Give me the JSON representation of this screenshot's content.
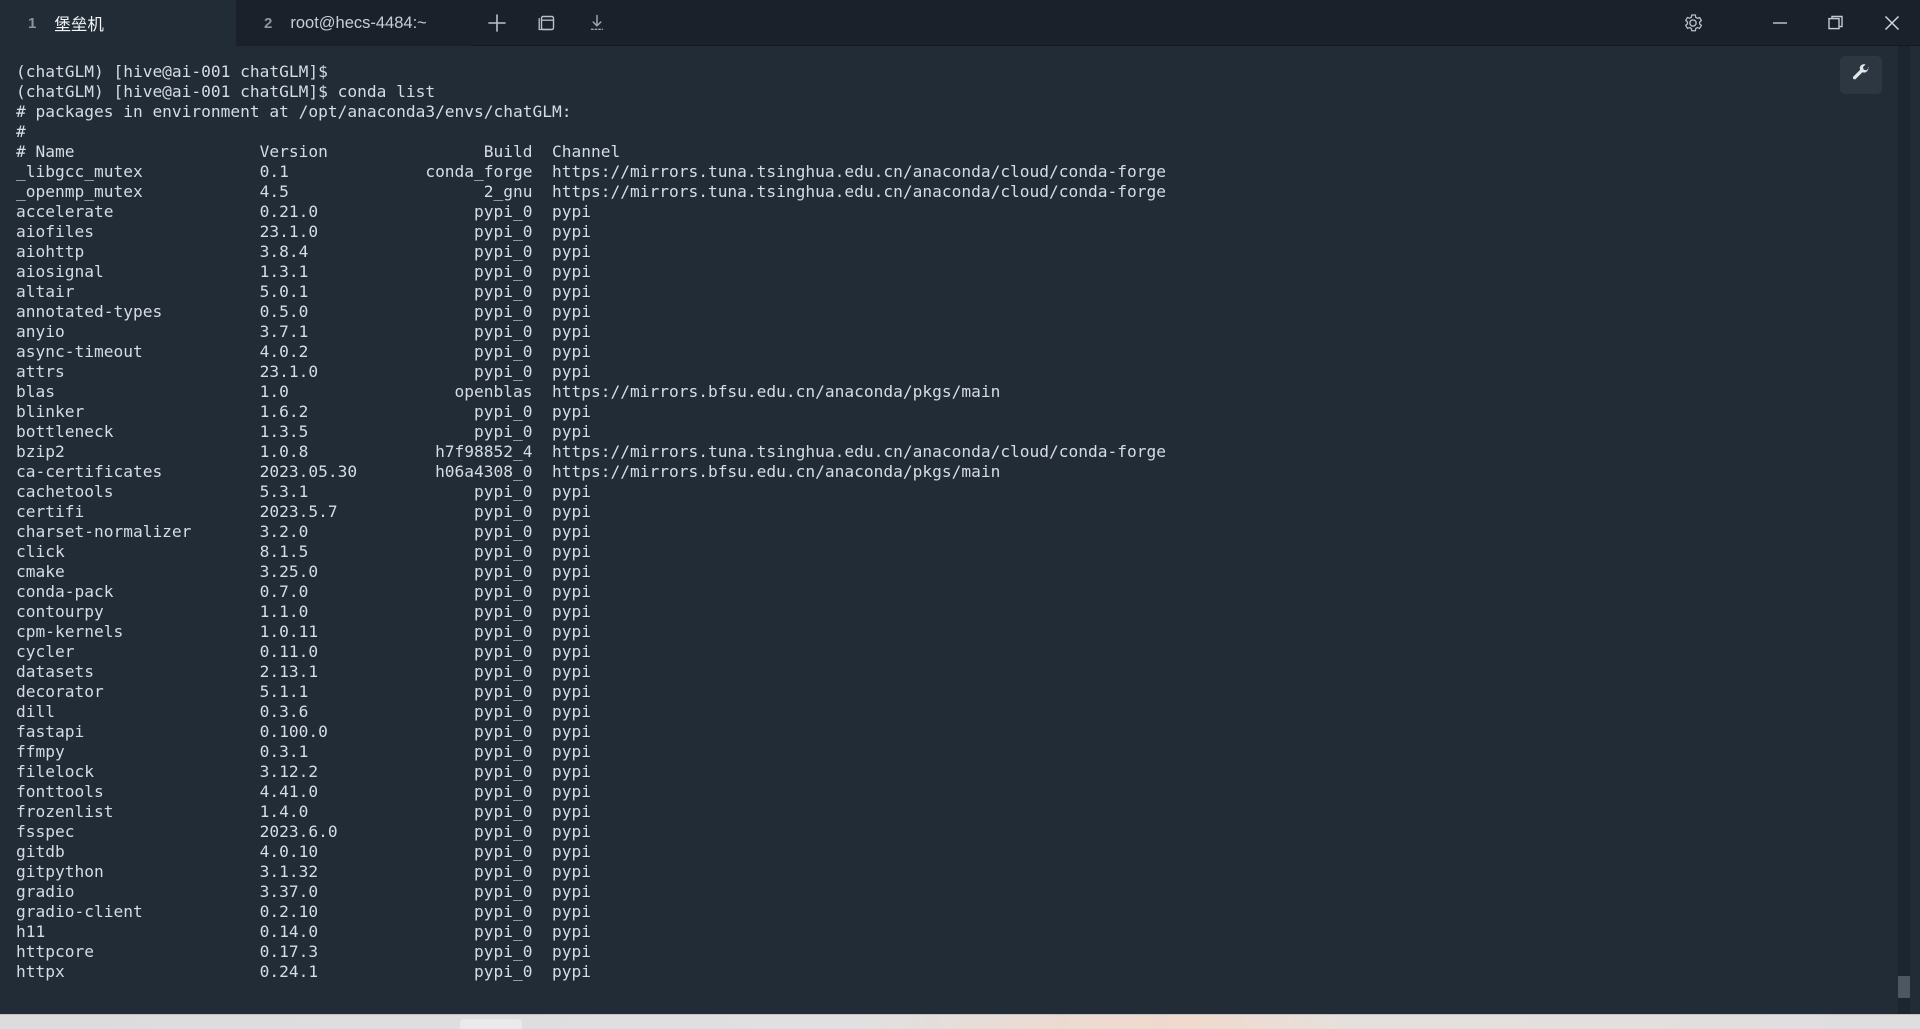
{
  "window": {
    "tabs": [
      {
        "number": "1",
        "label": "堡垒机",
        "active": true
      },
      {
        "number": "2",
        "label": "root@hecs-4484:~",
        "active": false
      }
    ],
    "tab_actions": [
      {
        "name": "new-tab-icon",
        "title": "+"
      },
      {
        "name": "split-window-icon",
        "title": "窗口"
      },
      {
        "name": "download-icon",
        "title": "下载"
      }
    ],
    "controls": [
      {
        "name": "gear-icon",
        "label": "设置"
      },
      {
        "name": "minimize-icon",
        "label": "最小化"
      },
      {
        "name": "restore-icon",
        "label": "还原"
      },
      {
        "name": "close-icon",
        "label": "关闭"
      }
    ],
    "tool_button": {
      "name": "wrench-icon",
      "label": "工具"
    }
  },
  "colors": {
    "terminal_bg": "#222c37",
    "titlebar_bg": "#1a212b",
    "active_tab_bg": "#222c37",
    "text": "#d6dce3",
    "scrollbar_thumb": "#4d5761"
  },
  "terminal": {
    "prompt": "(chatGLM) [hive@ai-001 chatGLM]$",
    "command": "conda list",
    "header_lines": [
      "(chatGLM) [hive@ai-001 chatGLM]$",
      "(chatGLM) [hive@ai-001 chatGLM]$ conda list",
      "# packages in environment at /opt/anaconda3/envs/chatGLM:",
      "#"
    ],
    "columns": {
      "name": "# Name",
      "version": "Version",
      "build": "Build",
      "channel": "Channel"
    },
    "column_offsets": {
      "name": 0,
      "version": 25,
      "build_end": 53,
      "channel": 56
    },
    "packages": [
      {
        "name": "_libgcc_mutex",
        "version": "0.1",
        "build": "conda_forge",
        "channel": "https://mirrors.tuna.tsinghua.edu.cn/anaconda/cloud/conda-forge"
      },
      {
        "name": "_openmp_mutex",
        "version": "4.5",
        "build": "2_gnu",
        "channel": "https://mirrors.tuna.tsinghua.edu.cn/anaconda/cloud/conda-forge"
      },
      {
        "name": "accelerate",
        "version": "0.21.0",
        "build": "pypi_0",
        "channel": "pypi"
      },
      {
        "name": "aiofiles",
        "version": "23.1.0",
        "build": "pypi_0",
        "channel": "pypi"
      },
      {
        "name": "aiohttp",
        "version": "3.8.4",
        "build": "pypi_0",
        "channel": "pypi"
      },
      {
        "name": "aiosignal",
        "version": "1.3.1",
        "build": "pypi_0",
        "channel": "pypi"
      },
      {
        "name": "altair",
        "version": "5.0.1",
        "build": "pypi_0",
        "channel": "pypi"
      },
      {
        "name": "annotated-types",
        "version": "0.5.0",
        "build": "pypi_0",
        "channel": "pypi"
      },
      {
        "name": "anyio",
        "version": "3.7.1",
        "build": "pypi_0",
        "channel": "pypi"
      },
      {
        "name": "async-timeout",
        "version": "4.0.2",
        "build": "pypi_0",
        "channel": "pypi"
      },
      {
        "name": "attrs",
        "version": "23.1.0",
        "build": "pypi_0",
        "channel": "pypi"
      },
      {
        "name": "blas",
        "version": "1.0",
        "build": "openblas",
        "channel": "https://mirrors.bfsu.edu.cn/anaconda/pkgs/main"
      },
      {
        "name": "blinker",
        "version": "1.6.2",
        "build": "pypi_0",
        "channel": "pypi"
      },
      {
        "name": "bottleneck",
        "version": "1.3.5",
        "build": "pypi_0",
        "channel": "pypi"
      },
      {
        "name": "bzip2",
        "version": "1.0.8",
        "build": "h7f98852_4",
        "channel": "https://mirrors.tuna.tsinghua.edu.cn/anaconda/cloud/conda-forge"
      },
      {
        "name": "ca-certificates",
        "version": "2023.05.30",
        "build": "h06a4308_0",
        "channel": "https://mirrors.bfsu.edu.cn/anaconda/pkgs/main"
      },
      {
        "name": "cachetools",
        "version": "5.3.1",
        "build": "pypi_0",
        "channel": "pypi"
      },
      {
        "name": "certifi",
        "version": "2023.5.7",
        "build": "pypi_0",
        "channel": "pypi"
      },
      {
        "name": "charset-normalizer",
        "version": "3.2.0",
        "build": "pypi_0",
        "channel": "pypi"
      },
      {
        "name": "click",
        "version": "8.1.5",
        "build": "pypi_0",
        "channel": "pypi"
      },
      {
        "name": "cmake",
        "version": "3.25.0",
        "build": "pypi_0",
        "channel": "pypi"
      },
      {
        "name": "conda-pack",
        "version": "0.7.0",
        "build": "pypi_0",
        "channel": "pypi"
      },
      {
        "name": "contourpy",
        "version": "1.1.0",
        "build": "pypi_0",
        "channel": "pypi"
      },
      {
        "name": "cpm-kernels",
        "version": "1.0.11",
        "build": "pypi_0",
        "channel": "pypi"
      },
      {
        "name": "cycler",
        "version": "0.11.0",
        "build": "pypi_0",
        "channel": "pypi"
      },
      {
        "name": "datasets",
        "version": "2.13.1",
        "build": "pypi_0",
        "channel": "pypi"
      },
      {
        "name": "decorator",
        "version": "5.1.1",
        "build": "pypi_0",
        "channel": "pypi"
      },
      {
        "name": "dill",
        "version": "0.3.6",
        "build": "pypi_0",
        "channel": "pypi"
      },
      {
        "name": "fastapi",
        "version": "0.100.0",
        "build": "pypi_0",
        "channel": "pypi"
      },
      {
        "name": "ffmpy",
        "version": "0.3.1",
        "build": "pypi_0",
        "channel": "pypi"
      },
      {
        "name": "filelock",
        "version": "3.12.2",
        "build": "pypi_0",
        "channel": "pypi"
      },
      {
        "name": "fonttools",
        "version": "4.41.0",
        "build": "pypi_0",
        "channel": "pypi"
      },
      {
        "name": "frozenlist",
        "version": "1.4.0",
        "build": "pypi_0",
        "channel": "pypi"
      },
      {
        "name": "fsspec",
        "version": "2023.6.0",
        "build": "pypi_0",
        "channel": "pypi"
      },
      {
        "name": "gitdb",
        "version": "4.0.10",
        "build": "pypi_0",
        "channel": "pypi"
      },
      {
        "name": "gitpython",
        "version": "3.1.32",
        "build": "pypi_0",
        "channel": "pypi"
      },
      {
        "name": "gradio",
        "version": "3.37.0",
        "build": "pypi_0",
        "channel": "pypi"
      },
      {
        "name": "gradio-client",
        "version": "0.2.10",
        "build": "pypi_0",
        "channel": "pypi"
      },
      {
        "name": "h11",
        "version": "0.14.0",
        "build": "pypi_0",
        "channel": "pypi"
      },
      {
        "name": "httpcore",
        "version": "0.17.3",
        "build": "pypi_0",
        "channel": "pypi"
      },
      {
        "name": "httpx",
        "version": "0.24.1",
        "build": "pypi_0",
        "channel": "pypi"
      }
    ]
  }
}
